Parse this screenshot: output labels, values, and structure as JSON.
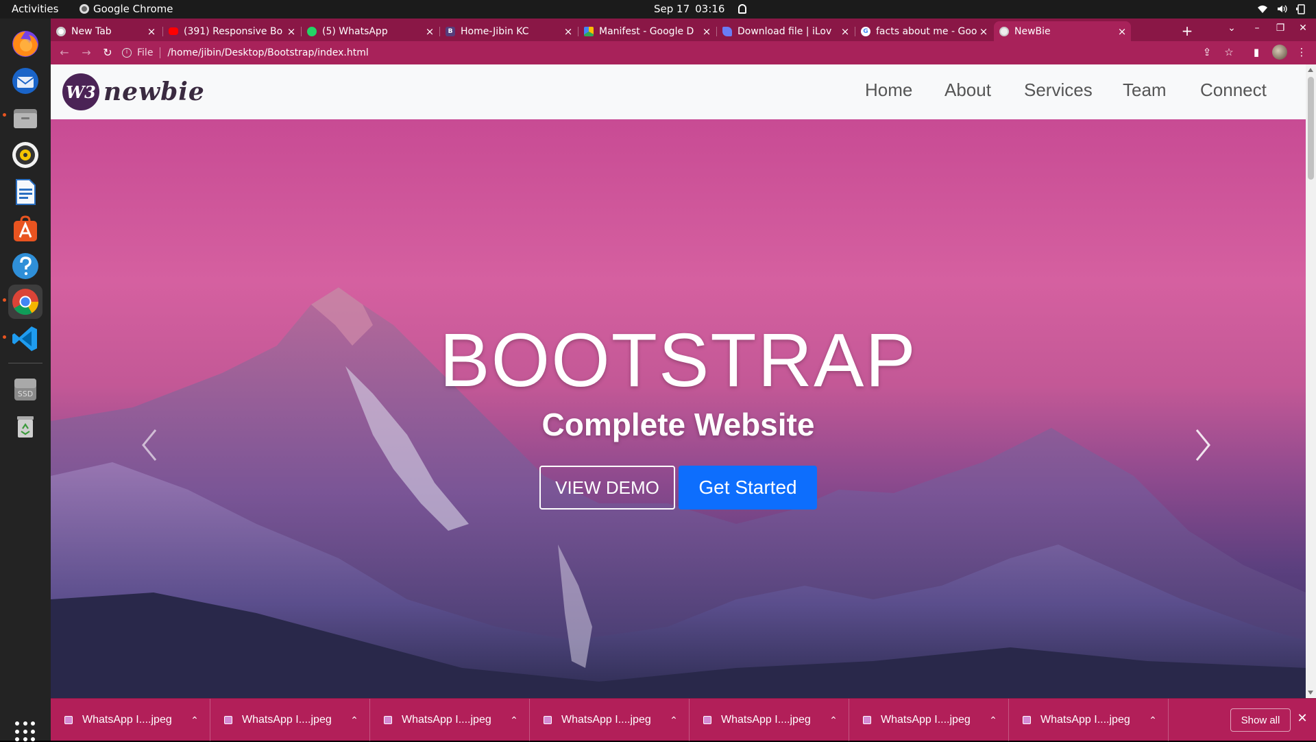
{
  "topbar": {
    "activities": "Activities",
    "app_name": "Google Chrome",
    "date": "Sep 17",
    "time": "03:16"
  },
  "dock": {
    "items": [
      "firefox",
      "thunderbird",
      "files",
      "rhythmbox",
      "libreoffice-writer",
      "software-center",
      "help",
      "chrome",
      "vscode",
      "ssd-drive",
      "trash"
    ],
    "ssd_label": "SSD"
  },
  "browser": {
    "tabs": [
      {
        "title": "New Tab",
        "favicon": "chrome-icon"
      },
      {
        "title": "(391) Responsive Bo",
        "favicon": "youtube-icon"
      },
      {
        "title": "(5) WhatsApp",
        "favicon": "whatsapp-icon"
      },
      {
        "title": "Home-Jibin KC",
        "favicon": "bootstrap-icon"
      },
      {
        "title": "Manifest - Google D",
        "favicon": "google-drive-icon"
      },
      {
        "title": "Download file | iLov",
        "favicon": "ilovepdf-icon"
      },
      {
        "title": "facts about me - Goo",
        "favicon": "google-icon"
      },
      {
        "title": "NewBie",
        "favicon": "globe-icon"
      }
    ],
    "active_tab": 7,
    "address": {
      "scheme": "File",
      "url": "/home/jibin/Desktop/Bootstrap/index.html"
    },
    "theme_color": "#a8225a"
  },
  "site": {
    "logo_mark": "W3",
    "logo_word": "newbie",
    "nav": [
      "Home",
      "About",
      "Services",
      "Team",
      "Connect"
    ],
    "hero": {
      "title": "BOOTSTRAP",
      "subtitle": "Complete Website",
      "demo_button": "VIEW DEMO",
      "start_button": "Get Started"
    }
  },
  "downloads": {
    "items": [
      "WhatsApp I....jpeg",
      "WhatsApp I....jpeg",
      "WhatsApp I....jpeg",
      "WhatsApp I....jpeg",
      "WhatsApp I....jpeg",
      "WhatsApp I....jpeg",
      "WhatsApp I....jpeg"
    ],
    "show_all": "Show all"
  }
}
